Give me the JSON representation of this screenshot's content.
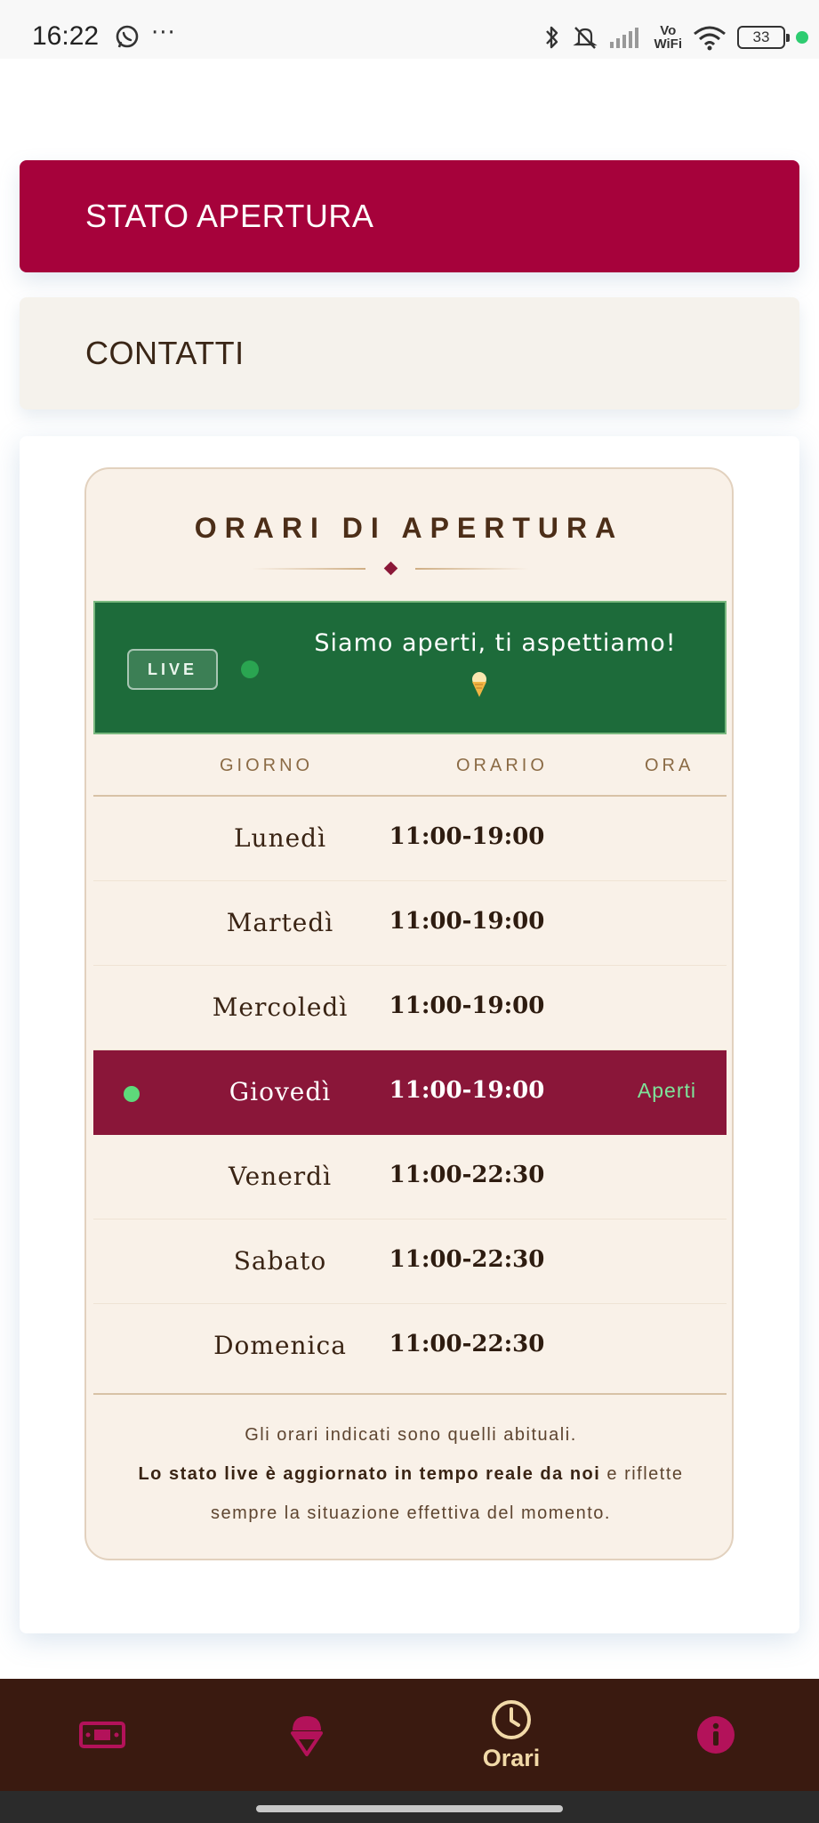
{
  "status_bar": {
    "time": "16:22",
    "battery": "33",
    "network": "Vo\nWiFi",
    "icons": [
      "whatsapp-icon",
      "more-dots-icon",
      "bluetooth-icon",
      "bell-off-icon",
      "signal-icon",
      "vowifi-icon",
      "wifi-icon",
      "battery-icon"
    ]
  },
  "tabs": {
    "stato": "STATO APERTURA",
    "contatti": "CONTATTI"
  },
  "hours_card": {
    "title": "ORARI DI APERTURA",
    "live_badge": "LIVE",
    "live_message": "Siamo aperti, ti aspettiamo!",
    "columns": {
      "day": "GIORNO",
      "hours": "ORARIO",
      "now": "ORA"
    },
    "rows": [
      {
        "day": "Lunedì",
        "hours": "11:00-19:00",
        "status": ""
      },
      {
        "day": "Martedì",
        "hours": "11:00-19:00",
        "status": ""
      },
      {
        "day": "Mercoledì",
        "hours": "11:00-19:00",
        "status": ""
      },
      {
        "day": "Giovedì",
        "hours": "11:00-19:00",
        "status": "Aperti"
      },
      {
        "day": "Venerdì",
        "hours": "11:00-22:30",
        "status": ""
      },
      {
        "day": "Sabato",
        "hours": "11:00-22:30",
        "status": ""
      },
      {
        "day": "Domenica",
        "hours": "11:00-22:30",
        "status": ""
      }
    ],
    "note_line1": "Gli orari indicati sono quelli abituali.",
    "note_bold": "Lo stato live è aggiornato in tempo reale da noi",
    "note_rest": " e riflette sempre la situazione effettiva del momento."
  },
  "bottom_nav": {
    "items": [
      {
        "icon": "banknote-icon",
        "label": ""
      },
      {
        "icon": "ice-cream-icon",
        "label": ""
      },
      {
        "icon": "clock-icon",
        "label": "Orari"
      },
      {
        "icon": "info-icon",
        "label": ""
      }
    ]
  },
  "colors": {
    "brand": "#a6023b",
    "live_green": "#1d6b3a",
    "today_row": "#8a1639",
    "nav_bg": "#3a1a10",
    "nav_active": "#f1d9a8"
  }
}
